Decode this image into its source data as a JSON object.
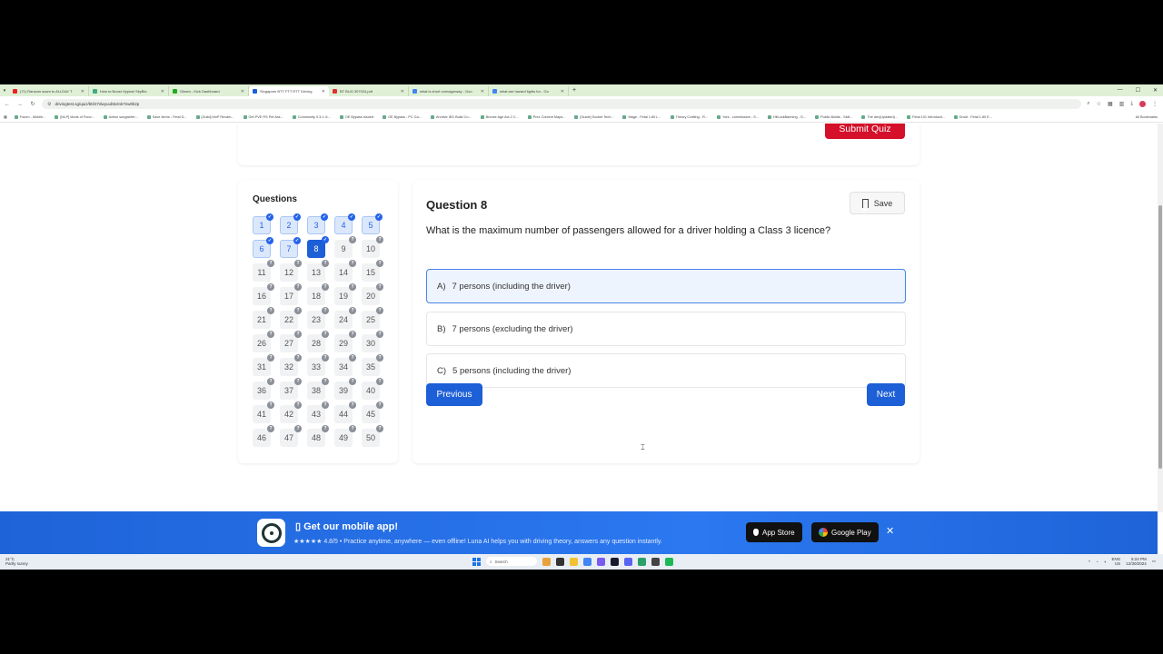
{
  "browser": {
    "tabs": [
      {
        "title": "(71) Ransom scam to ALLDAY T",
        "color": "#e22"
      },
      {
        "title": "How to Boost Hypixel SkyBlo",
        "color": "#4a8"
      },
      {
        "title": "Gleam - Kick Dashboard",
        "color": "#2a2"
      },
      {
        "title": "Singapore BTT FTT RTT Driving",
        "color": "#1d5fd6"
      },
      {
        "title": "BT BUG 307024.pdf",
        "color": "#d33"
      },
      {
        "title": "what is short cornagurway - Goo",
        "color": "#4285f4"
      },
      {
        "title": "what are hazard lights for - Go",
        "color": "#4285f4"
      }
    ],
    "active_tab_index": 3,
    "url": "drivingtest.sg/quiz/btt/27dwyuub5ctnk7nw0k2p",
    "bookmarks": [
      "Forum - Mobile...",
      "[MLP] Mods of Fund...",
      "Action songwriter...",
      "Save Items - Fetal D...",
      "[Guild] MoP Revam...",
      "Get PVE RS Pet Ass...",
      "Community 0.3.1 /4...",
      "OE Bypass Issued",
      "OE Bypass - PC Gu...",
      "Archive IED Build Co...",
      "Bronze Age Act 2 C...",
      "Prez Content Maps...",
      "[Guide] Socket Tech...",
      "Mage - Fetal 1.80 L...",
      "Theory Crafting - R...",
      "York - commission - S...",
      "HitLockBanning - G...",
      "Public Builds - Skill...",
      "The dev(Updated)...",
      "Fetal 101 Introducti...",
      "Druid - Fetal 1.80 E..."
    ],
    "all_bookmarks_label": "All Bookmarks"
  },
  "quiz": {
    "submit_label": "Submit Quiz",
    "questions_heading": "Questions",
    "questions": [
      {
        "n": "1",
        "state": "answered"
      },
      {
        "n": "2",
        "state": "answered"
      },
      {
        "n": "3",
        "state": "answered"
      },
      {
        "n": "4",
        "state": "answered"
      },
      {
        "n": "5",
        "state": "answered"
      },
      {
        "n": "6",
        "state": "answered"
      },
      {
        "n": "7",
        "state": "answered"
      },
      {
        "n": "8",
        "state": "current"
      },
      {
        "n": "9",
        "state": "unanswered"
      },
      {
        "n": "10",
        "state": "unanswered"
      },
      {
        "n": "11",
        "state": "unanswered"
      },
      {
        "n": "12",
        "state": "unanswered"
      },
      {
        "n": "13",
        "state": "unanswered"
      },
      {
        "n": "14",
        "state": "unanswered"
      },
      {
        "n": "15",
        "state": "unanswered"
      },
      {
        "n": "16",
        "state": "unanswered"
      },
      {
        "n": "17",
        "state": "unanswered"
      },
      {
        "n": "18",
        "state": "unanswered"
      },
      {
        "n": "19",
        "state": "unanswered"
      },
      {
        "n": "20",
        "state": "unanswered"
      },
      {
        "n": "21",
        "state": "unanswered"
      },
      {
        "n": "22",
        "state": "unanswered"
      },
      {
        "n": "23",
        "state": "unanswered"
      },
      {
        "n": "24",
        "state": "unanswered"
      },
      {
        "n": "25",
        "state": "unanswered"
      },
      {
        "n": "26",
        "state": "unanswered"
      },
      {
        "n": "27",
        "state": "unanswered"
      },
      {
        "n": "28",
        "state": "unanswered"
      },
      {
        "n": "29",
        "state": "unanswered"
      },
      {
        "n": "30",
        "state": "unanswered"
      },
      {
        "n": "31",
        "state": "unanswered"
      },
      {
        "n": "32",
        "state": "unanswered"
      },
      {
        "n": "33",
        "state": "unanswered"
      },
      {
        "n": "34",
        "state": "unanswered"
      },
      {
        "n": "35",
        "state": "unanswered"
      },
      {
        "n": "36",
        "state": "unanswered"
      },
      {
        "n": "37",
        "state": "unanswered"
      },
      {
        "n": "38",
        "state": "unanswered"
      },
      {
        "n": "39",
        "state": "unanswered"
      },
      {
        "n": "40",
        "state": "unanswered"
      },
      {
        "n": "41",
        "state": "unanswered"
      },
      {
        "n": "42",
        "state": "unanswered"
      },
      {
        "n": "43",
        "state": "unanswered"
      },
      {
        "n": "44",
        "state": "unanswered"
      },
      {
        "n": "45",
        "state": "unanswered"
      },
      {
        "n": "46",
        "state": "unanswered"
      },
      {
        "n": "47",
        "state": "unanswered"
      },
      {
        "n": "48",
        "state": "unanswered"
      },
      {
        "n": "49",
        "state": "unanswered"
      },
      {
        "n": "50",
        "state": "unanswered"
      }
    ],
    "current": {
      "title": "Question 8",
      "save_label": "Save",
      "text": "What is the maximum number of passengers allowed for a driver holding a Class 3 licence?",
      "options": [
        {
          "letter": "A)",
          "text": "7 persons (including the driver)",
          "selected": true
        },
        {
          "letter": "B)",
          "text": "7 persons (excluding the driver)",
          "selected": false
        },
        {
          "letter": "C)",
          "text": "5 persons (including the driver)",
          "selected": false
        }
      ]
    },
    "prev_label": "Previous",
    "next_label": "Next"
  },
  "banner": {
    "title": "Get our mobile app!",
    "stars": "★★★★★",
    "rating": "4.8/5",
    "subtitle": "• Practice anytime, anywhere — even offline! Luna AI helps you with driving theory, answers any question instantly.",
    "app_store": "App Store",
    "google_play": "Google Play",
    "close": "✕"
  },
  "taskbar": {
    "weather_temp": "31°C",
    "weather_desc": "Partly sunny",
    "search_label": "Search",
    "lang": "ENG",
    "lang_sub": "US",
    "time": "5:24 PM",
    "date": "12/30/2024"
  },
  "colors": {
    "primary": "#1d5fd6",
    "submit": "#d4102a",
    "banner": "#2b78f0"
  }
}
